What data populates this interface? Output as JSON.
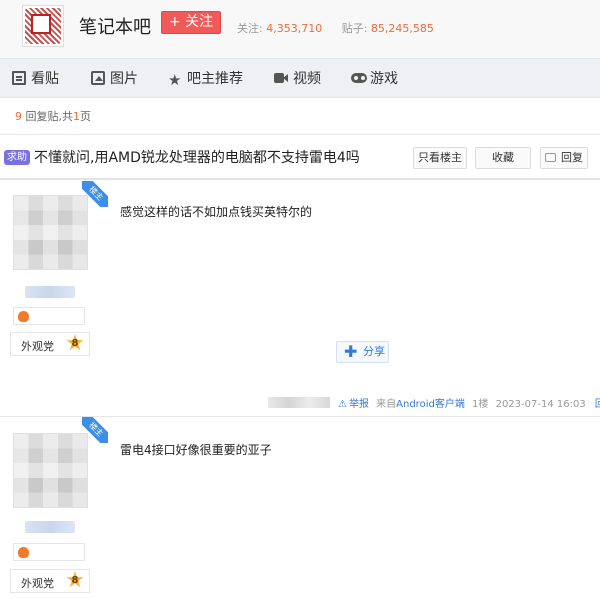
{
  "header": {
    "forum_name": "笔记本吧",
    "follow_label": "+ 关注",
    "follow_count_label": "关注:",
    "follow_count": "4,353,710",
    "post_count_label": "贴子:",
    "post_count": "85,245,585",
    "logo_icon": "forum-seal-logo"
  },
  "nav": {
    "items": [
      {
        "label": "看贴",
        "icon": "document-icon"
      },
      {
        "label": "图片",
        "icon": "image-icon"
      },
      {
        "label": "吧主推荐",
        "icon": "star-icon"
      },
      {
        "label": "视频",
        "icon": "video-icon"
      },
      {
        "label": "游戏",
        "icon": "gamepad-icon"
      }
    ]
  },
  "reply_info": {
    "count": "9",
    "count_suffix": "回复贴,共",
    "pages": "1",
    "pages_suffix": "页"
  },
  "thread": {
    "tag": "求助",
    "title": "不懂就问,用AMD锐龙处理器的电脑都不支持雷电4吗",
    "only_op_label": "只看楼主",
    "favorite_label": "收藏",
    "reply_label": "回复"
  },
  "posts": [
    {
      "ribbon": "楼主",
      "level_name": "外观党",
      "level": "8",
      "content": "感觉这样的话不如加点钱买英特尔的",
      "share_label": "分享",
      "report_label": "举报",
      "client": "来自Android客户端",
      "floor": "1楼",
      "time": "2023-07-14 16:03",
      "reply_label": "回复"
    },
    {
      "ribbon": "楼主",
      "level_name": "外观党",
      "level": "8",
      "content": "雷电4接口好像很重要的亚子"
    }
  ],
  "colors": {
    "accent_orange": "#f06a3b",
    "follow_red": "#f25a5a",
    "link_blue": "#3579d8",
    "tag_purple": "#7a70e6",
    "ribbon_blue": "#3c8fe8"
  }
}
